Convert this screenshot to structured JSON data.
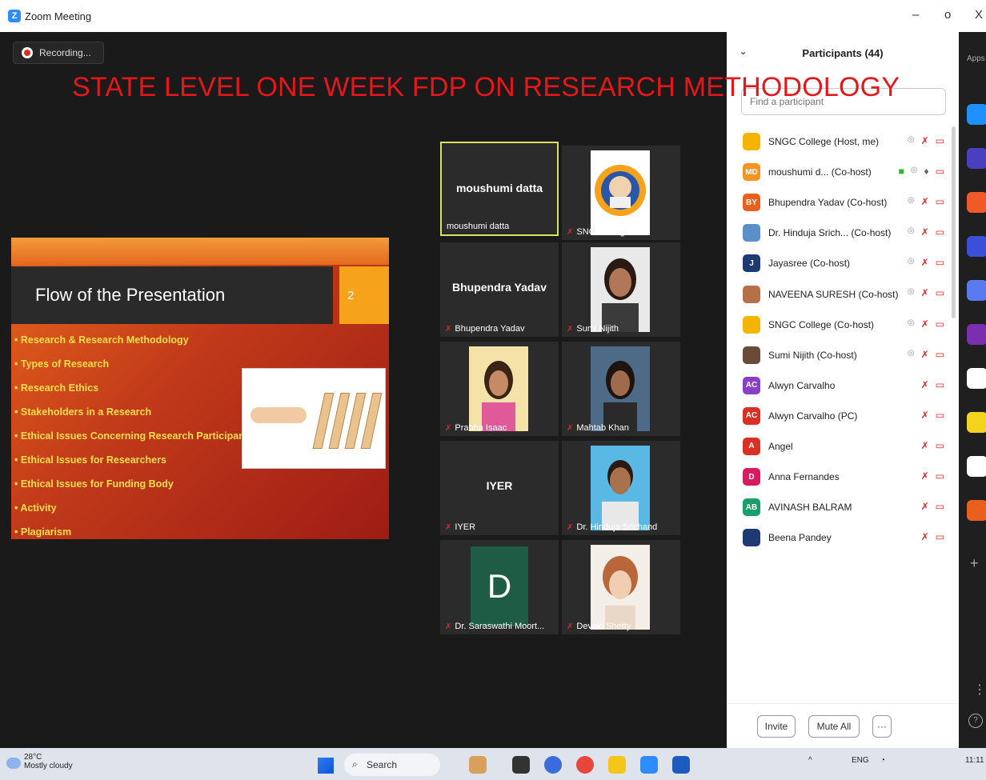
{
  "window": {
    "title": "Zoom Meeting",
    "minimize": "–",
    "restore": "o",
    "close": "X"
  },
  "recording": {
    "label": "Recording..."
  },
  "overlay_title": "STATE LEVEL ONE WEEK FDP ON RESEARCH METHODOLOGY",
  "slide": {
    "title": "Flow of the Presentation",
    "number": "2",
    "bullets": [
      "Research & Research Methodology",
      "Types of Research",
      "Research Ethics",
      "Stakeholders in a Research",
      "Ethical Issues Concerning Research Participants",
      "Ethical Issues for Researchers",
      "Ethical Issues for Funding Body",
      "Activity",
      "Plagiarism"
    ]
  },
  "tiles": [
    {
      "big_name": "moushumi datta",
      "label": "moushumi datta",
      "active": true
    },
    {
      "big_name": "",
      "label": "SNGCcollege"
    },
    {
      "big_name": "Bhupendra Yadav",
      "label": "Bhupendra Yadav"
    },
    {
      "big_name": "",
      "label": "Sumi Nijith"
    },
    {
      "big_name": "",
      "label": "Prabha Isaac"
    },
    {
      "big_name": "",
      "label": "Mahtab Khan"
    },
    {
      "big_name": "IYER",
      "label": "IYER"
    },
    {
      "big_name": "",
      "label": "Dr. Hinduja Srichand"
    },
    {
      "big_name": "D",
      "label": "Dr. Saraswathi Moort..."
    },
    {
      "big_name": "",
      "label": "Devaki Shetty"
    }
  ],
  "participants": {
    "title": "Participants (44)",
    "search_placeholder": "Find a participant",
    "list": [
      {
        "initials": "",
        "name": "SNGC College (Host, me)",
        "color": "#f4b400"
      },
      {
        "initials": "MD",
        "name": "moushumi d... (Co-host)",
        "color": "#f7931e"
      },
      {
        "initials": "BY",
        "name": "Bhupendra Yadav (Co-host)",
        "color": "#e8601c"
      },
      {
        "initials": "",
        "name": "Dr. Hinduja Srich... (Co-host)",
        "color": "#5a8fc8"
      },
      {
        "initials": "J",
        "name": "Jayasree (Co-host)",
        "color": "#1f3a73"
      },
      {
        "initials": "",
        "name": "NAVEENA SURESH (Co-host)",
        "color": "#b5704a"
      },
      {
        "initials": "",
        "name": "SNGC College (Co-host)",
        "color": "#f4b400"
      },
      {
        "initials": "",
        "name": "Sumi Nijith (Co-host)",
        "color": "#6b4a3a"
      },
      {
        "initials": "AC",
        "name": "Alwyn Carvalho",
        "color": "#8a3fc7"
      },
      {
        "initials": "AC",
        "name": "Alwyn Carvalho (PC)",
        "color": "#d93025"
      },
      {
        "initials": "A",
        "name": "Angel",
        "color": "#d93025"
      },
      {
        "initials": "D",
        "name": "Anna Fernandes",
        "color": "#d81b60"
      },
      {
        "initials": "AB",
        "name": "AVINASH BALRAM",
        "color": "#1a9e6b"
      },
      {
        "initials": "",
        "name": "Beena Pandey",
        "color": "#1f3a73"
      }
    ],
    "invite": "Invite",
    "mute_all": "Mute All",
    "more": "···"
  },
  "apps_label": "Apps",
  "taskbar": {
    "temperature": "28°C",
    "weather": "Mostly cloudy",
    "search": "Search",
    "lang": "ENG",
    "time": "11:11"
  },
  "colors": {
    "accent": "#2d8cff",
    "overlay_red": "#e4171b",
    "active_tile": "#d7e35f"
  }
}
